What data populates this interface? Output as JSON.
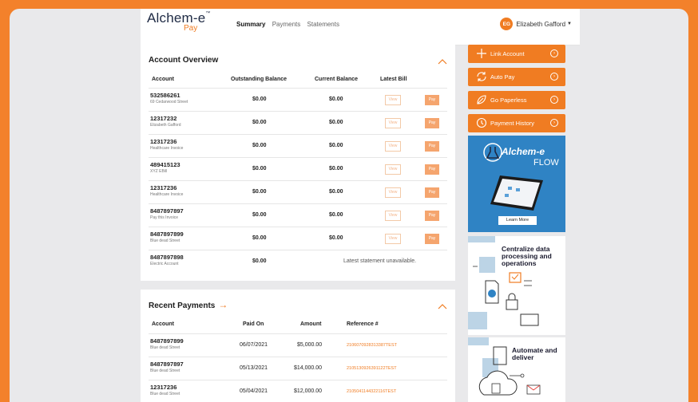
{
  "brand": {
    "name": "Alchem-e",
    "tm": "™",
    "sub": "Pay"
  },
  "nav": {
    "items": [
      "Summary",
      "Payments",
      "Statements"
    ],
    "active": "Summary"
  },
  "user": {
    "initials": "EG",
    "name": "Elizabeth Gafford"
  },
  "overview": {
    "title": "Account Overview",
    "headers": {
      "account": "Account",
      "outstanding": "Outstanding Balance",
      "current": "Current Balance",
      "latest": "Latest Bill"
    },
    "view_label": "View",
    "pay_label": "Pay",
    "rows": [
      {
        "account": "532586261",
        "sub": "69 Cedarwood Street",
        "outstanding": "$0.00",
        "current": "$0.00"
      },
      {
        "account": "12317232",
        "sub": "Elizabeth Gafford",
        "outstanding": "$0.00",
        "current": "$0.00"
      },
      {
        "account": "12317236",
        "sub": "Healthcare Invoice",
        "outstanding": "$0.00",
        "current": "$0.00"
      },
      {
        "account": "489415123",
        "sub": "XYZ EBill",
        "outstanding": "$0.00",
        "current": "$0.00"
      },
      {
        "account": "12317236",
        "sub": "Healthcare Invoice",
        "outstanding": "$0.00",
        "current": "$0.00"
      },
      {
        "account": "8487897897",
        "sub": "Pay this Invoice",
        "outstanding": "$0.00",
        "current": "$0.00"
      },
      {
        "account": "8487897899",
        "sub": "Blue dead Street",
        "outstanding": "$0.00",
        "current": "$0.00"
      },
      {
        "account": "8487897898",
        "sub": "Electric Account",
        "outstanding": "$0.00",
        "unavailable": "Latest statement unavailable."
      }
    ]
  },
  "payments": {
    "title": "Recent Payments",
    "arrow": "→",
    "headers": {
      "account": "Account",
      "paid_on": "Paid On",
      "amount": "Amount",
      "reference": "Reference #"
    },
    "rows": [
      {
        "account": "8487897899",
        "sub": "Blue dead Street",
        "paid_on": "06/07/2021",
        "amount": "$5,000.00",
        "reference": "2106070928313387TEST"
      },
      {
        "account": "8487897897",
        "sub": "Blue dead Street",
        "paid_on": "05/13/2021",
        "amount": "$14,000.00",
        "reference": "2105130926391122TEST"
      },
      {
        "account": "12317236",
        "sub": "Blue dead Street",
        "paid_on": "05/04/2021",
        "amount": "$12,000.00",
        "reference": "2105041144322116TEST"
      }
    ]
  },
  "actions": [
    {
      "label": "Link Account",
      "icon": "plus-icon"
    },
    {
      "label": "Auto Pay",
      "icon": "sync-icon"
    },
    {
      "label": "Go Paperless",
      "icon": "leaf-icon"
    },
    {
      "label": "Payment History",
      "icon": "history-icon"
    }
  ],
  "ads": {
    "flow": {
      "brand": "Alchem-e",
      "product": "FLOW",
      "cta": "Learn More"
    },
    "centralize": {
      "text": "Centralize data processing and operations"
    },
    "automate": {
      "text": "Automate and deliver"
    }
  },
  "colors": {
    "accent": "#F07C22",
    "background": "#F3812B",
    "ad_blue": "#2F83C4"
  }
}
